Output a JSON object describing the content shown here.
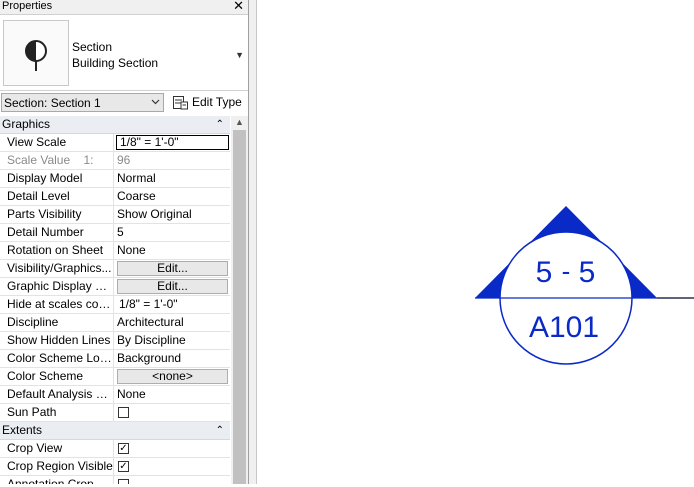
{
  "palette": {
    "title": "Properties",
    "close_glyph": "✕"
  },
  "type_selector": {
    "icon": "section-icon",
    "family": "Section",
    "type": "Building Section",
    "dropdown_glyph": "▼"
  },
  "instance": {
    "selected": "Section: Section 1",
    "edit_type_label": "Edit Type",
    "edit_type_icon": "edit-type-icon"
  },
  "groups": {
    "graphics": {
      "label": "Graphics",
      "caret": "⌃"
    },
    "extents": {
      "label": "Extents",
      "caret": "⌃"
    }
  },
  "graphics_rows": {
    "view_scale": {
      "name": "View Scale",
      "value": "1/8\" = 1'-0\""
    },
    "scale_value": {
      "name": "Scale Value    1:",
      "value": "96"
    },
    "display_model": {
      "name": "Display Model",
      "value": "Normal"
    },
    "detail_level": {
      "name": "Detail Level",
      "value": "Coarse"
    },
    "parts_visibility": {
      "name": "Parts Visibility",
      "value": "Show Original"
    },
    "detail_number": {
      "name": "Detail Number",
      "value": "5"
    },
    "rotation_on_sheet": {
      "name": "Rotation on Sheet",
      "value": "None"
    },
    "visibility_graphics": {
      "name": "Visibility/Graphics...",
      "value": "Edit..."
    },
    "graphic_display": {
      "name": "Graphic Display O...",
      "value": "Edit..."
    },
    "hide_at_scales": {
      "name": "Hide at scales coa...",
      "value": "1/8\" = 1'-0\""
    },
    "discipline": {
      "name": "Discipline",
      "value": "Architectural"
    },
    "show_hidden_lines": {
      "name": "Show Hidden Lines",
      "value": "By Discipline"
    },
    "color_scheme_location": {
      "name": "Color Scheme Loc...",
      "value": "Background"
    },
    "color_scheme": {
      "name": "Color Scheme",
      "value": "<none>"
    },
    "default_analysis": {
      "name": "Default Analysis D...",
      "value": "None"
    },
    "sun_path": {
      "name": "Sun Path",
      "checked": false
    }
  },
  "extents_rows": {
    "crop_view": {
      "name": "Crop View",
      "checked": true,
      "check_glyph": "✓"
    },
    "crop_region_visible": {
      "name": "Crop Region Visible",
      "checked": true,
      "check_glyph": "✓"
    },
    "annotation_crop": {
      "name": "Annotation Crop",
      "checked": false
    }
  },
  "section_head": {
    "detail_number": "5",
    "separator": "-",
    "detail_number_right": "5",
    "sheet_number": "A101",
    "color": "#0a2ac8"
  }
}
